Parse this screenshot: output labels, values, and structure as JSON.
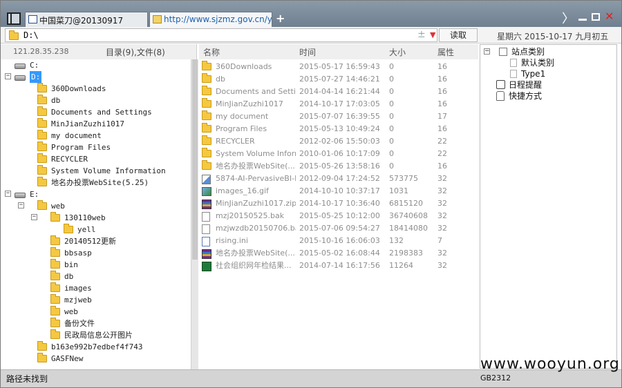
{
  "tabs": [
    {
      "label": "中国菜刀@20130917",
      "active": true
    },
    {
      "label": "http://www.sjzmz.gov.cn/yell...",
      "active": false
    }
  ],
  "window_controls": {
    "new_tab": "+",
    "next": "〉",
    "close": "✕"
  },
  "address": {
    "value": "D:\\",
    "plus": "±",
    "dropdown": "▼",
    "read_button": "读取"
  },
  "date": "星期六 2015-10-17 九月初五",
  "left_header": {
    "ip": "121.28.35.238",
    "summary": "目录(9),文件(8)"
  },
  "tree": [
    {
      "label": "C:",
      "type": "drive",
      "indent": 1,
      "toggle": ""
    },
    {
      "label": "D:",
      "type": "drive",
      "indent": 1,
      "toggle": "−",
      "selected": true
    },
    {
      "label": "360Downloads",
      "type": "folder",
      "indent": 2
    },
    {
      "label": "db",
      "type": "folder",
      "indent": 2
    },
    {
      "label": "Documents and Settings",
      "type": "folder",
      "indent": 2
    },
    {
      "label": "MinJianZuzhi1017",
      "type": "folder",
      "indent": 2
    },
    {
      "label": "my document",
      "type": "folder",
      "indent": 2
    },
    {
      "label": "Program Files",
      "type": "folder",
      "indent": 2
    },
    {
      "label": "RECYCLER",
      "type": "folder",
      "indent": 2
    },
    {
      "label": "System Volume Information",
      "type": "folder",
      "indent": 2
    },
    {
      "label": "地名办投票WebSite(5.25)",
      "type": "folder",
      "indent": 2
    },
    {
      "label": "E:",
      "type": "drive",
      "indent": 1,
      "toggle": "−"
    },
    {
      "label": "web",
      "type": "folder",
      "indent": 2,
      "toggle": "−"
    },
    {
      "label": "130110web",
      "type": "folder",
      "indent": 3,
      "toggle": "−"
    },
    {
      "label": "yell",
      "type": "folder",
      "indent": 4
    },
    {
      "label": "20140512更新",
      "type": "folder",
      "indent": 3
    },
    {
      "label": "bbsasp",
      "type": "folder",
      "indent": 3
    },
    {
      "label": "bin",
      "type": "folder",
      "indent": 3
    },
    {
      "label": "db",
      "type": "folder",
      "indent": 3
    },
    {
      "label": "images",
      "type": "folder",
      "indent": 3
    },
    {
      "label": "mzjweb",
      "type": "folder",
      "indent": 3
    },
    {
      "label": "web",
      "type": "folder",
      "indent": 3
    },
    {
      "label": "备份文件",
      "type": "folder",
      "indent": 3
    },
    {
      "label": "民政局信息公开图片",
      "type": "folder",
      "indent": 3
    },
    {
      "label": "b163e992b7edbef4f743",
      "type": "folder",
      "indent": 2
    },
    {
      "label": "GASFNew",
      "type": "folder",
      "indent": 2
    }
  ],
  "list_columns": {
    "name": "名称",
    "time": "时间",
    "size": "大小",
    "attr": "属性"
  },
  "files": [
    {
      "name": "360Downloads",
      "time": "2015-05-17 16:59:43",
      "size": "0",
      "attr": "16",
      "icon": "folder"
    },
    {
      "name": "db",
      "time": "2015-07-27 14:46:21",
      "size": "0",
      "attr": "16",
      "icon": "folder"
    },
    {
      "name": "Documents and Settings",
      "time": "2014-04-14 16:21:44",
      "size": "0",
      "attr": "16",
      "icon": "folder"
    },
    {
      "name": "MinJianZuzhi1017",
      "time": "2014-10-17 17:03:05",
      "size": "0",
      "attr": "16",
      "icon": "folder"
    },
    {
      "name": "my document",
      "time": "2015-07-07 16:39:55",
      "size": "0",
      "attr": "17",
      "icon": "folder"
    },
    {
      "name": "Program Files",
      "time": "2015-05-13 10:49:24",
      "size": "0",
      "attr": "16",
      "icon": "folder"
    },
    {
      "name": "RECYCLER",
      "time": "2012-02-06 15:50:03",
      "size": "0",
      "attr": "22",
      "icon": "folder"
    },
    {
      "name": "System Volume Inform...",
      "time": "2010-01-06 10:17:09",
      "size": "0",
      "attr": "22",
      "icon": "folder"
    },
    {
      "name": "地名办投票WebSite(...",
      "time": "2015-05-26 13:58:16",
      "size": "0",
      "attr": "16",
      "icon": "folder"
    },
    {
      "name": "5874-AI-PervasiveBI-M...",
      "time": "2012-09-04 17:24:52",
      "size": "573775",
      "attr": "32",
      "icon": "pen"
    },
    {
      "name": "images_16.gif",
      "time": "2014-10-10 10:37:17",
      "size": "1031",
      "attr": "32",
      "icon": "image"
    },
    {
      "name": "MinJianZuzhi1017.zip",
      "time": "2014-10-17 10:36:40",
      "size": "6815120",
      "attr": "32",
      "icon": "zip"
    },
    {
      "name": "mzj20150525.bak",
      "time": "2015-05-25 10:12:00",
      "size": "36740608",
      "attr": "32",
      "icon": "doc"
    },
    {
      "name": "mzjwzdb20150706.bak",
      "time": "2015-07-06 09:54:27",
      "size": "18414080",
      "attr": "32",
      "icon": "doc"
    },
    {
      "name": "rising.ini",
      "time": "2015-10-16 16:06:03",
      "size": "132",
      "attr": "7",
      "icon": "ini"
    },
    {
      "name": "地名办投票WebSite(...",
      "time": "2015-05-02 16:08:44",
      "size": "2198383",
      "attr": "32",
      "icon": "zip"
    },
    {
      "name": "社会组织网年检结果...",
      "time": "2014-07-14 16:17:56",
      "size": "11264",
      "attr": "32",
      "icon": "xls"
    }
  ],
  "right_panel": {
    "site_category": "站点类别",
    "default_category": "默认类别",
    "type1": "Type1",
    "reminder": "日程提醒",
    "shortcuts": "快捷方式"
  },
  "status": {
    "message": "路径未找到",
    "encoding": "GB2312"
  },
  "watermark": "www.wooyun.org"
}
